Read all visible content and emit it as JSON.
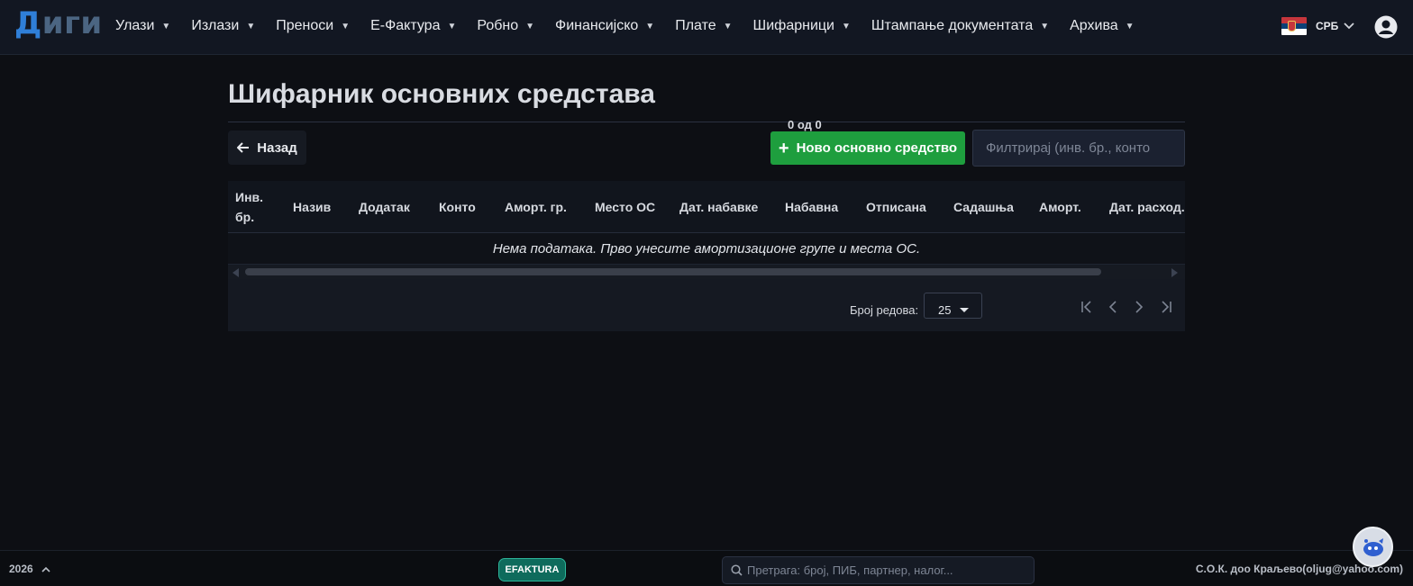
{
  "app": {
    "logo_first": "Д",
    "logo_rest": "иги"
  },
  "nav": {
    "items": [
      {
        "label": "Улази"
      },
      {
        "label": "Излази"
      },
      {
        "label": "Преноси"
      },
      {
        "label": "Е-Фактура"
      },
      {
        "label": "Робно"
      },
      {
        "label": "Финансијско"
      },
      {
        "label": "Плате"
      },
      {
        "label": "Шифарници"
      },
      {
        "label": "Штампање документата"
      },
      {
        "label": "Архива"
      }
    ],
    "caret": "▼",
    "language": "СРБ",
    "language_icon": "serbia-flag-icon"
  },
  "page": {
    "title": "Шифарник основних средстава",
    "back_label": "Назад",
    "new_label": "Ново основно средство",
    "filter_placeholder": "Филтрирај (инв. бр., конто"
  },
  "table": {
    "columns": [
      {
        "label": "Инв. бр."
      },
      {
        "label": "Назив"
      },
      {
        "label": "Додатак"
      },
      {
        "label": "Конто"
      },
      {
        "label": "Аморт. гр."
      },
      {
        "label": "Место ОС"
      },
      {
        "label": "Дат. набавке"
      },
      {
        "label": "Набавна"
      },
      {
        "label": "Отписана"
      },
      {
        "label": "Садашња"
      },
      {
        "label": "Аморт."
      },
      {
        "label": "Дат. расход."
      }
    ],
    "empty_message": "Нема података. Прво унесите амортизационе групе и места ОС.",
    "rows": []
  },
  "pagination": {
    "rows_label": "Број редова:",
    "rows_per_page": "25",
    "range": "0 од 0"
  },
  "footer": {
    "year": "2026",
    "efaktura_badge": "EFAKTURA",
    "search_placeholder": "Претрага: број, ПИБ, партнер, налог...",
    "company": "С.О.К. доо Краљево(oljug@yahoo.com)"
  },
  "colors": {
    "background": "#0d0f14",
    "topbar": "#121722",
    "accent_green": "#1e9e3e",
    "logo_blue": "#2f7fd8",
    "efaktura_teal": "#0e6b5c"
  }
}
